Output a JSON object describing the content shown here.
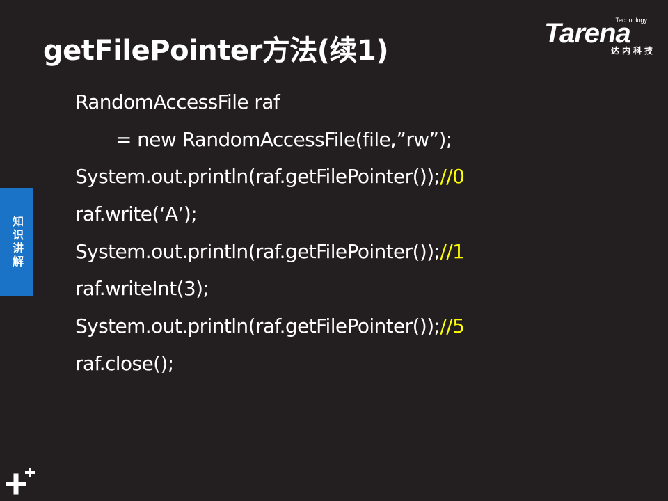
{
  "slide": {
    "title": "getFilePointer方法(续1)",
    "logo": {
      "tagline": "Technology",
      "wordmark": "Tarena",
      "subtitle": "达内科技"
    },
    "side_tab": "知识讲解",
    "code_lines": [
      {
        "code": "RandomAccessFile raf",
        "comment": ""
      },
      {
        "code": "= new RandomAccessFile(file,”rw”);",
        "comment": ""
      },
      {
        "code": "System.out.println(raf.getFilePointer());",
        "comment": "//0"
      },
      {
        "code": "raf.write(‘A’);",
        "comment": ""
      },
      {
        "code": "System.out.println(raf.getFilePointer());",
        "comment": "//1"
      },
      {
        "code": "raf.writeInt(3);",
        "comment": ""
      },
      {
        "code": "System.out.println(raf.getFilePointer());",
        "comment": "//5"
      },
      {
        "code": "raf.close();",
        "comment": ""
      }
    ],
    "colors": {
      "background": "#231f20",
      "text": "#ffffff",
      "comment": "#ffff00",
      "side_tab": "#1a73c6"
    },
    "icons": [
      "plus-plus-icon"
    ]
  }
}
